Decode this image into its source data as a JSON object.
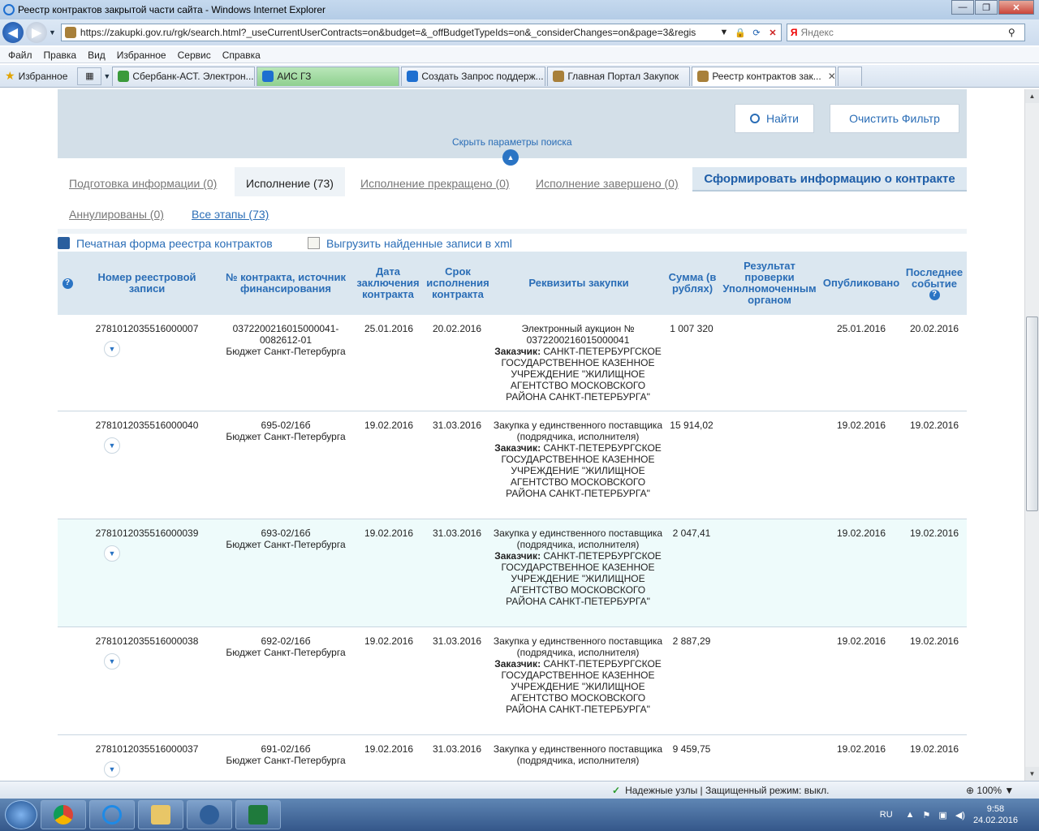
{
  "window": {
    "title": "Реестр контрактов закрытой части сайта - Windows Internet Explorer",
    "min": "—",
    "max": "❐",
    "close": "✕"
  },
  "address": {
    "url": "https://zakupki.gov.ru/rgk/search.html?_useCurrentUserContracts=on&budget=&_offBudgetTypeIds=on&_considerChanges=on&page=3&regis",
    "search_placeholder": "Яндекс"
  },
  "menu": [
    "Файл",
    "Правка",
    "Вид",
    "Избранное",
    "Сервис",
    "Справка"
  ],
  "favorites": {
    "label": "Избранное",
    "tabs": [
      "Сбербанк-АСТ. Электрон...",
      "АИС ГЗ",
      "Создать Запрос поддерж...",
      "Главная Портал Закупок",
      "Реестр контрактов зак..."
    ]
  },
  "search_panel": {
    "find_label": "Найти",
    "clear_label": "Очистить Фильтр",
    "hide_params": "Скрыть параметры поиска"
  },
  "status_tabs": {
    "prep": "Подготовка информации (0)",
    "exec": "Исполнение (73)",
    "stopped": "Исполнение прекращено (0)",
    "done": "Исполнение завершено (0)",
    "form_button": "Сформировать информацию о контракте",
    "cancelled": "Аннулированы (0)",
    "all": "Все этапы (73)"
  },
  "actions": {
    "print": "Печатная форма реестра контрактов",
    "export": "Выгрузить найденные записи в xml"
  },
  "table": {
    "headers": {
      "help": "?",
      "reg_number": "Номер реестровой записи",
      "contract": "№ контракта, источник финансирования",
      "date": "Дата заключения контракта",
      "term": "Срок исполнения контракта",
      "requisites": "Реквизиты закупки",
      "sum": "Сумма (в рублях)",
      "check": "Результат проверки Уполномоченным органом",
      "published": "Опубликовано",
      "last_event": "Последнее событие"
    },
    "customer_label": "Заказчик:",
    "rows": [
      {
        "reg": "2781012035516000007",
        "contract_no": "0372200216015000041-0082612-01",
        "source": "Бюджет Санкт-Петербурга",
        "date": "25.01.2016",
        "term": "20.02.2016",
        "purchase": "Электронный аукцион № 0372200216015000041",
        "customer": "САНКТ-ПЕТЕРБУРГСКОЕ ГОСУДАРСТВЕННОЕ КАЗЕННОЕ УЧРЕЖДЕНИЕ \"ЖИЛИЩНОЕ АГЕНТСТВО МОСКОВСКОГО РАЙОНА САНКТ-ПЕТЕРБУРГА\"",
        "sum": "1 007 320",
        "check": "",
        "published": "25.01.2016",
        "last_event": "20.02.2016"
      },
      {
        "reg": "2781012035516000040",
        "contract_no": "695-02/16б",
        "source": "Бюджет Санкт-Петербурга",
        "date": "19.02.2016",
        "term": "31.03.2016",
        "purchase": "Закупка у единственного поставщика (подрядчика, исполнителя)",
        "customer": "САНКТ-ПЕТЕРБУРГСКОЕ ГОСУДАРСТВЕННОЕ КАЗЕННОЕ УЧРЕЖДЕНИЕ \"ЖИЛИЩНОЕ АГЕНТСТВО МОСКОВСКОГО РАЙОНА САНКТ-ПЕТЕРБУРГА\"",
        "sum": "15 914,02",
        "check": "",
        "published": "19.02.2016",
        "last_event": "19.02.2016"
      },
      {
        "reg": "2781012035516000039",
        "contract_no": "693-02/16б",
        "source": "Бюджет Санкт-Петербурга",
        "date": "19.02.2016",
        "term": "31.03.2016",
        "purchase": "Закупка у единственного поставщика (подрядчика, исполнителя)",
        "customer": "САНКТ-ПЕТЕРБУРГСКОЕ ГОСУДАРСТВЕННОЕ КАЗЕННОЕ УЧРЕЖДЕНИЕ \"ЖИЛИЩНОЕ АГЕНТСТВО МОСКОВСКОГО РАЙОНА САНКТ-ПЕТЕРБУРГА\"",
        "sum": "2 047,41",
        "check": "",
        "published": "19.02.2016",
        "last_event": "19.02.2016"
      },
      {
        "reg": "2781012035516000038",
        "contract_no": "692-02/16б",
        "source": "Бюджет Санкт-Петербурга",
        "date": "19.02.2016",
        "term": "31.03.2016",
        "purchase": "Закупка у единственного поставщика (подрядчика, исполнителя)",
        "customer": "САНКТ-ПЕТЕРБУРГСКОЕ ГОСУДАРСТВЕННОЕ КАЗЕННОЕ УЧРЕЖДЕНИЕ \"ЖИЛИЩНОЕ АГЕНТСТВО МОСКОВСКОГО РАЙОНА САНКТ-ПЕТЕРБУРГА\"",
        "sum": "2 887,29",
        "check": "",
        "published": "19.02.2016",
        "last_event": "19.02.2016"
      },
      {
        "reg": "2781012035516000037",
        "contract_no": "691-02/16б",
        "source": "Бюджет Санкт-Петербурга",
        "date": "19.02.2016",
        "term": "31.03.2016",
        "purchase": "Закупка у единственного поставщика (подрядчика, исполнителя)",
        "customer": "",
        "sum": "9 459,75",
        "check": "",
        "published": "19.02.2016",
        "last_event": "19.02.2016"
      }
    ]
  },
  "statusbar": {
    "zone": "Надежные узлы | Защищенный режим: выкл.",
    "zoom": "100%"
  },
  "taskbar": {
    "lang": "RU",
    "time": "9:58",
    "date": "24.02.2016"
  },
  "colors": {
    "accent": "#2a6db6",
    "panel": "#d3dfe8",
    "header": "#dbe7f0",
    "highlight_row": "#eefbfb"
  }
}
